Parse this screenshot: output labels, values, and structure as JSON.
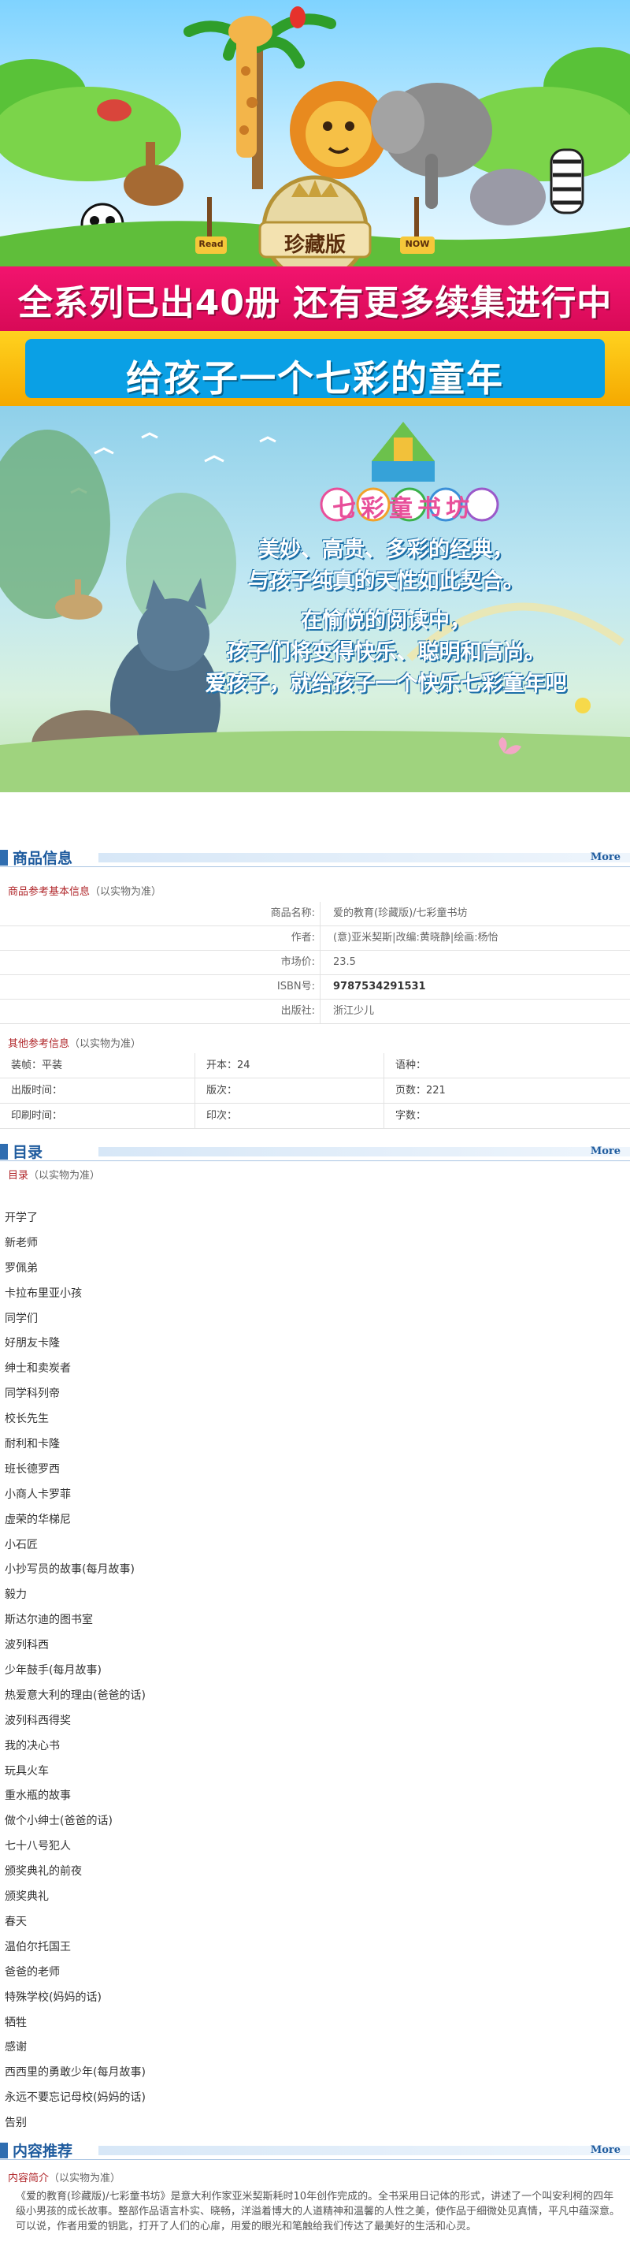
{
  "banner": {
    "headline": "全系列已出40册  还有更多续集进行中",
    "tagline": "给孩子一个七彩的童年",
    "badge": "珍藏版",
    "sign_left": "Read",
    "sign_right": "NOW",
    "brand": "七彩童书坊",
    "slogan_lines": [
      "美妙、高贵、多彩的经典，",
      "与孩子纯真的天性如此契合。",
      "在愉悦的阅读中，",
      "孩子们将变得快乐、聪明和高尚。",
      "爱孩子，就给孩子一个快乐七彩童年吧"
    ]
  },
  "product_section": {
    "title": "商品信息",
    "more": "More",
    "basic_title": "商品参考基本信息",
    "basic_note": "（以实物为准）",
    "rows": [
      {
        "label": "商品名称:",
        "value": "爱的教育(珍藏版)/七彩童书坊"
      },
      {
        "label": "作者:",
        "value": "(意)亚米契斯|改编:黄晓静|绘画:杨怡"
      },
      {
        "label": "市场价:",
        "value": "23.5"
      },
      {
        "label": "ISBN号:",
        "value": "9787534291531"
      },
      {
        "label": "出版社:",
        "value": "浙江少儿"
      }
    ],
    "other_title": "其他参考信息",
    "other_note": "（以实物为准）",
    "other_rows": [
      [
        "装帧：平装",
        "开本：24",
        "语种："
      ],
      [
        "出版时间：",
        "版次：",
        "页数：221"
      ],
      [
        "印刷时间：",
        "印次：",
        "字数："
      ]
    ]
  },
  "toc_section": {
    "title": "目录",
    "more": "More",
    "sub_title": "目录",
    "sub_note": "（以实物为准）",
    "items": [
      "开学了",
      "新老师",
      "罗佩弟",
      "卡拉布里亚小孩",
      "同学们",
      "好朋友卡隆",
      "绅士和卖炭者",
      "同学科列帝",
      "校长先生",
      "耐利和卡隆",
      "班长德罗西",
      "小商人卡罗菲",
      "虚荣的华梯尼",
      "小石匠",
      "小抄写员的故事(每月故事)",
      "毅力",
      "斯达尔迪的图书室",
      "波列科西",
      "少年鼓手(每月故事)",
      "热爱意大利的理由(爸爸的话)",
      "波列科西得奖",
      "我的决心书",
      "玩具火车",
      "重水瓶的故事",
      "做个小绅士(爸爸的话)",
      "七十八号犯人",
      "颁奖典礼的前夜",
      "颁奖典礼",
      "春天",
      "温伯尔托国王",
      "爸爸的老师",
      "特殊学校(妈妈的话)",
      "牺牲",
      "感谢",
      "西西里的勇敢少年(每月故事)",
      "永远不要忘记母校(妈妈的话)",
      "告别"
    ]
  },
  "recommend_section": {
    "title": "内容推荐",
    "more": "More",
    "sub_title": "内容简介",
    "sub_note": "（以实物为准）",
    "intro": "《爱的教育(珍藏版)/七彩童书坊》是意大利作家亚米契斯耗时10年创作完成的。全书采用日记体的形式，讲述了一个叫安利柯的四年级小男孩的成长故事。整部作品语言朴实、晓畅，洋溢着博大的人道精神和温馨的人性之美，使作品于细微处见真情，平凡中蕴深意。可以说，作者用爱的钥匙，打开了人们的心扉，用爱的眼光和笔触给我们传达了最美好的生活和心灵。"
  },
  "colors": {
    "headline_bg": "#e0105f",
    "tagline_bg": "#0aa0e5",
    "section_blue": "#1e5b9e",
    "subtitle_red": "#b0262a"
  }
}
